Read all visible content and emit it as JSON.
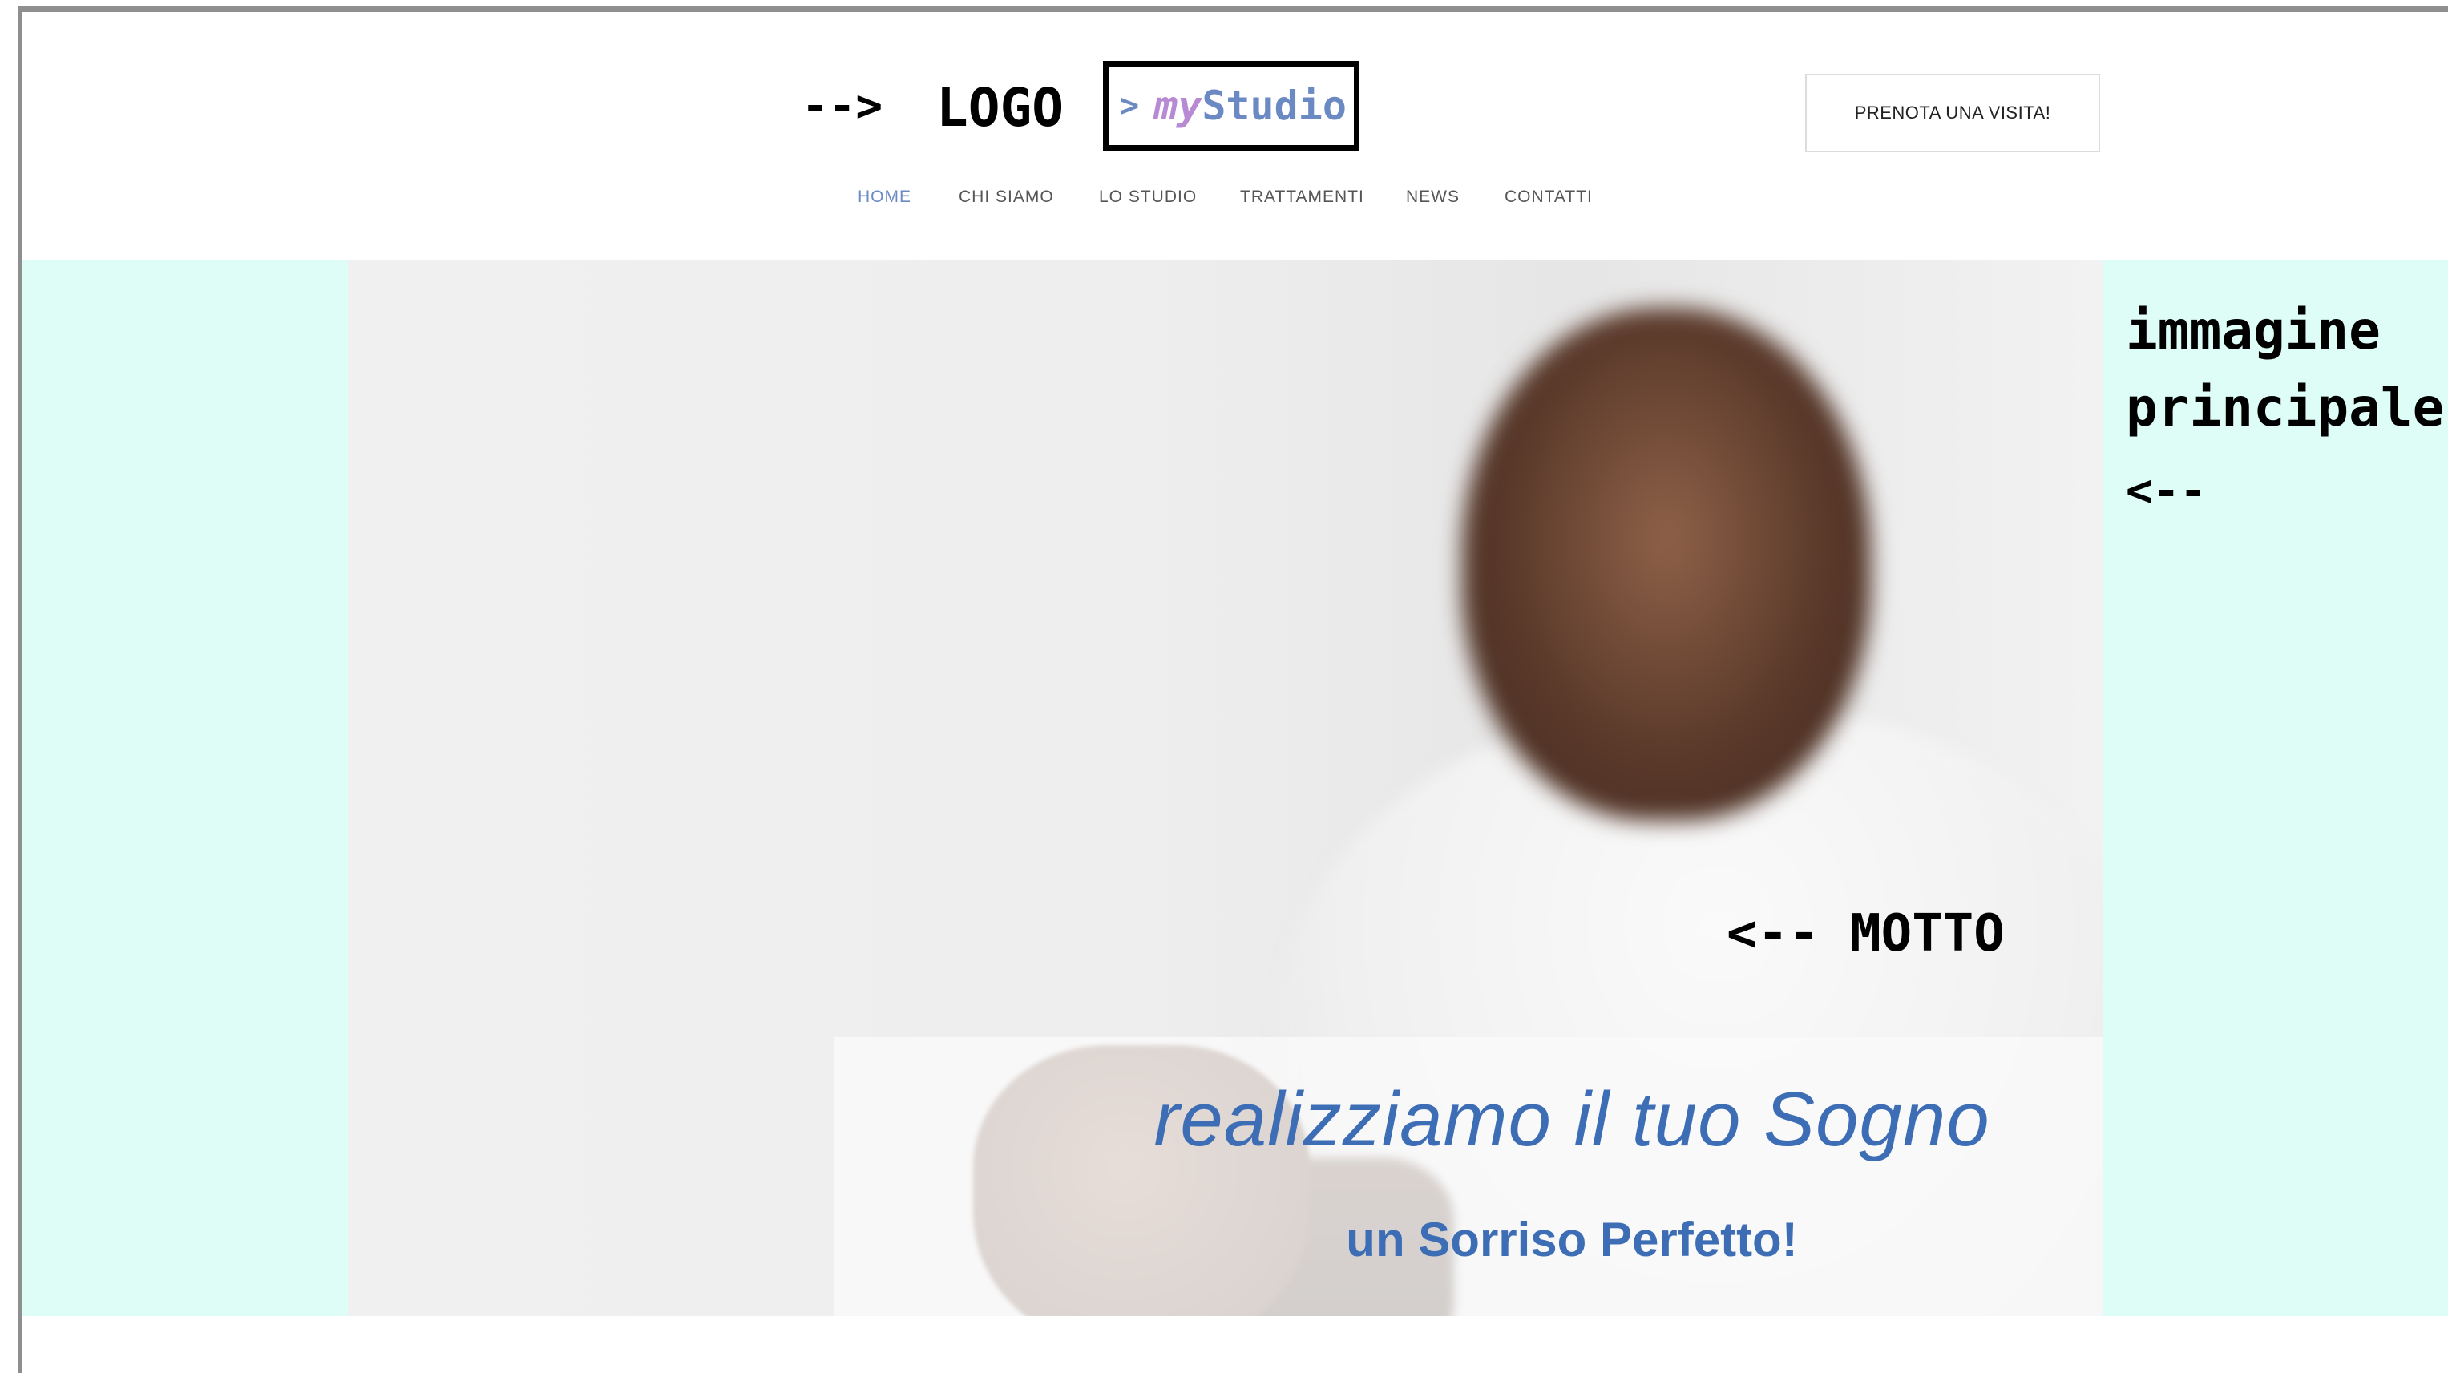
{
  "annotations": {
    "logo_arrow": "-->",
    "logo_label": "LOGO",
    "image_label_line1": "immagine",
    "image_label_line2": "principale",
    "image_arrow": "<--",
    "motto_label": "<-- MOTTO"
  },
  "logo": {
    "chevron": ">",
    "brand_prefix": "my",
    "brand_suffix": "Studio"
  },
  "header": {
    "cta_label": "PRENOTA UNA VISITA!"
  },
  "nav": {
    "items": [
      {
        "label": "HOME",
        "active": true
      },
      {
        "label": "CHI SIAMO"
      },
      {
        "label": "LO STUDIO"
      },
      {
        "label": "TRATTAMENTI"
      },
      {
        "label": "NEWS"
      },
      {
        "label": "CONTATTI"
      }
    ]
  },
  "hero": {
    "motto_main": "realizziamo il tuo Sogno",
    "motto_sub": "un Sorriso Perfetto!"
  },
  "colors": {
    "accent": "#6b89c2",
    "brand_my": "#b98ad4",
    "motto_blue": "#3c6db5",
    "hero_bg": "#ddfdf6"
  }
}
